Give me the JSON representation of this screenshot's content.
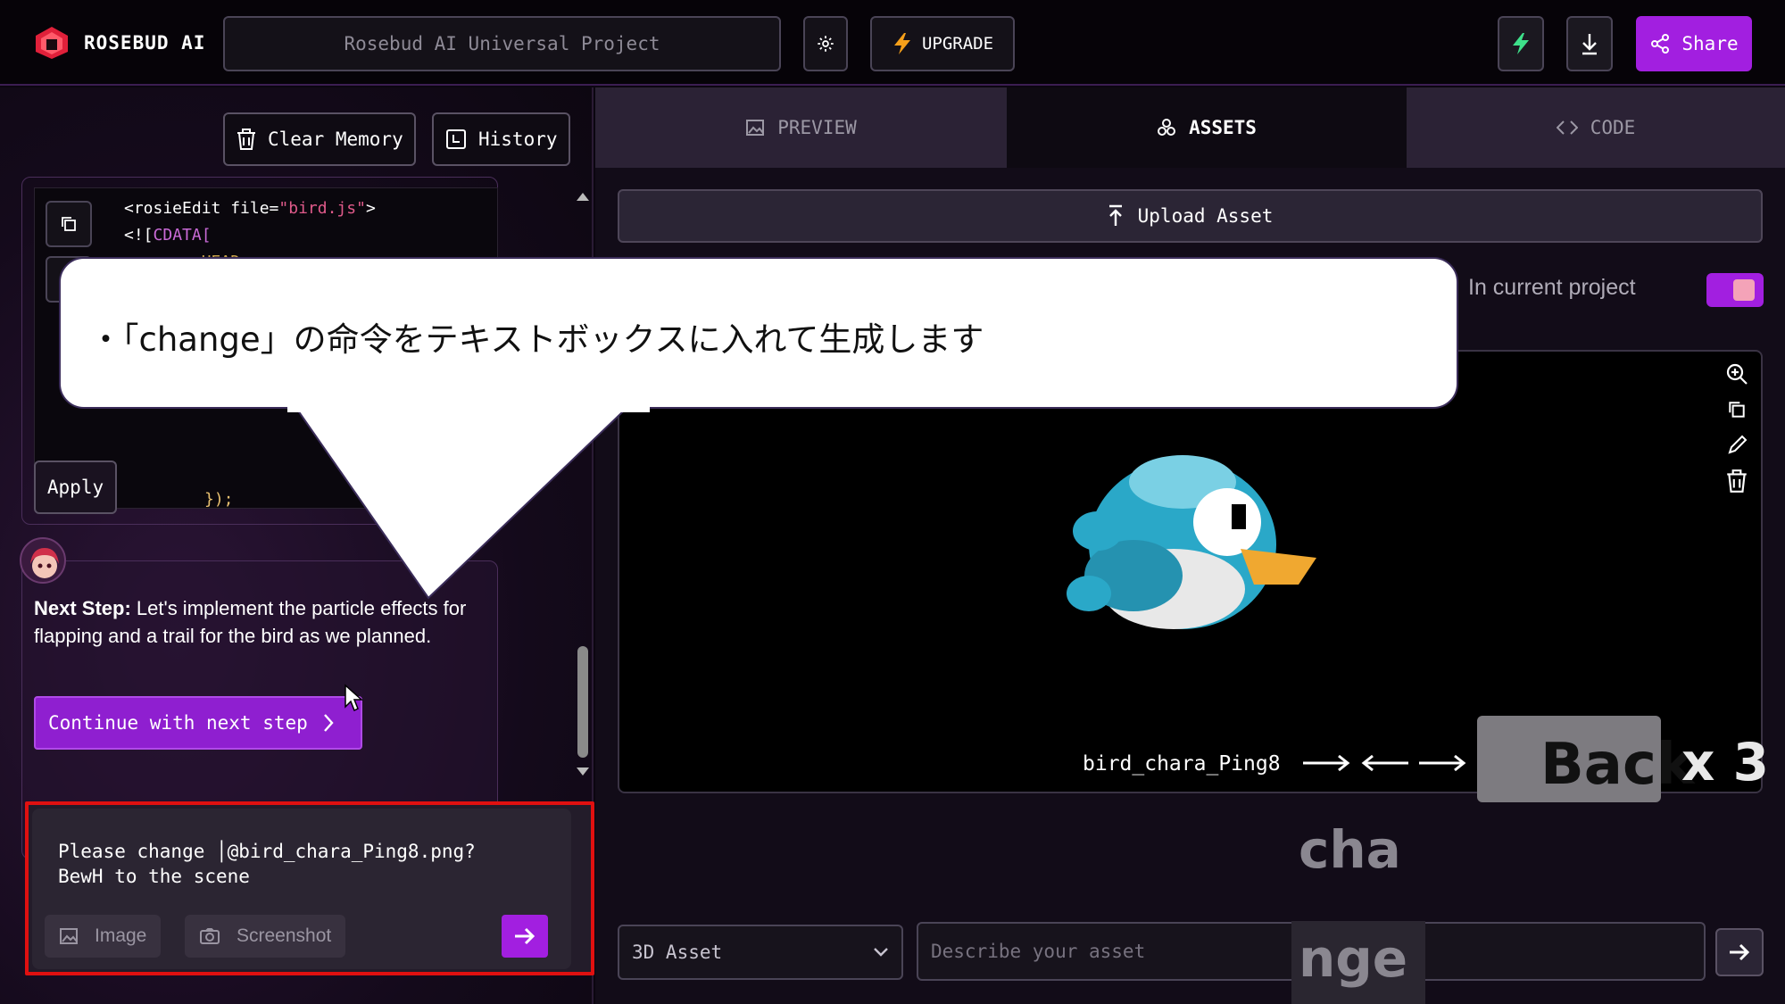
{
  "app": {
    "brand": "ROSEBUD AI",
    "project_name": "Rosebud AI Universal Project",
    "upgrade_label": "UPGRADE",
    "share_label": "Share",
    "accent": "#a21fe0"
  },
  "left": {
    "clear_memory_label": "Clear Memory",
    "history_label": "History",
    "code_lines": [
      "<rosieEdit file=\"bird.js\">",
      "<![CDATA[",
      "<<<<<<< HEAD"
    ],
    "code_tail": "});",
    "apply_label": "Apply",
    "message_bold": "Next Step:",
    "message_text": " Let's implement the particle effects for flapping and a trail for the bird as we planned.",
    "continue_label": "Continue with next step",
    "input_text": "Please change │@bird_chara_Ping8.png?\nBewH to the scene",
    "image_label": "Image",
    "screenshot_label": "Screenshot"
  },
  "right": {
    "tabs": [
      {
        "label": "PREVIEW"
      },
      {
        "label": "ASSETS"
      },
      {
        "label": "CODE"
      }
    ],
    "upload_label": "Upload Asset",
    "in_current_project_label": "In current project",
    "toggle_on": true,
    "asset_name": "bird_chara_Ping8",
    "asset_type": "3D Asset",
    "describe_placeholder": "Describe your asset"
  },
  "overlay": {
    "bubble_text": "・「change」の命令をテキストボックスに入れて生成します",
    "key_label": "Back",
    "key_count": "x 3",
    "typed_1": "cha",
    "typed_2": "nge"
  }
}
